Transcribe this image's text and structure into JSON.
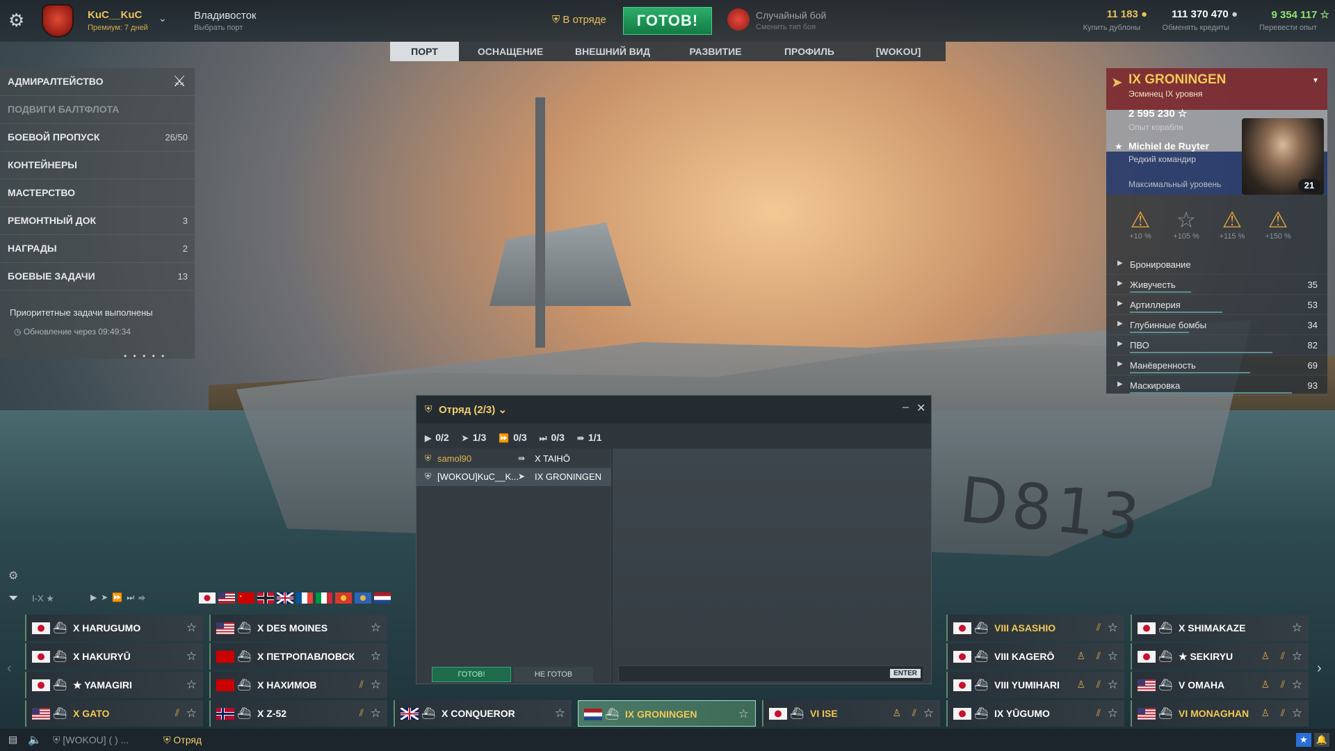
{
  "topbar": {
    "player_name": "KuC__KuC",
    "premium": "Премиум: 7 дней",
    "port_name": "Владивосток",
    "port_sub": "Выбрать порт",
    "division": "В отряде",
    "ready": "ГОТОВ!",
    "mode_name": "Случайный бой",
    "mode_sub": "Сменить тип боя",
    "doubloons": "11 183",
    "doubloons_sub": "Купить дублоны",
    "credits": "111 370 470",
    "credits_sub": "Обменять кредиты",
    "freexp": "9 354 117",
    "freexp_sub": "Перевести опыт"
  },
  "tabs": [
    "ПОРТ",
    "ОСНАЩЕНИЕ",
    "ВНЕШНИЙ ВИД",
    "РАЗВИТИЕ",
    "ПРОФИЛЬ",
    "[WOKOU]"
  ],
  "left_menu": [
    {
      "label": "АДМИРАЛТЕЙСТВО",
      "count": "",
      "dim": false
    },
    {
      "label": "ПОДВИГИ БАЛТФЛОТА",
      "count": "",
      "dim": true
    },
    {
      "label": "БОЕВОЙ ПРОПУСК",
      "count": "26/50",
      "dim": false
    },
    {
      "label": "КОНТЕЙНЕРЫ",
      "count": "",
      "dim": false
    },
    {
      "label": "МАСТЕРСТВО",
      "count": "",
      "dim": false
    },
    {
      "label": "РЕМОНТНЫЙ ДОК",
      "count": "3",
      "dim": false
    },
    {
      "label": "НАГРАДЫ",
      "count": "2",
      "dim": false
    },
    {
      "label": "БОЕВЫЕ ЗАДАЧИ",
      "count": "13",
      "dim": false
    }
  ],
  "left_footer": {
    "priority": "Приоритетные задачи выполнены",
    "update": "Обновление через 09:49:34"
  },
  "ship": {
    "name": "IX GRONINGEN",
    "class": "Эсминец IX уровня",
    "xp": "2 595 230",
    "xp_sub": "Опыт корабля",
    "commander": "Michiel de Ruyter",
    "commander_sub": "Редкий командир",
    "commander_level": "Максимальный уровень",
    "points": "21",
    "modifiers": [
      {
        "value": "+10 %",
        "color": "#e3a23c"
      },
      {
        "value": "+105 %",
        "color": "#8d959b"
      },
      {
        "value": "+115 %",
        "color": "#e3a23c"
      },
      {
        "value": "+150 %",
        "color": "#e3a23c"
      }
    ],
    "stats": [
      {
        "name": "Бронирование",
        "value": "",
        "level": 0
      },
      {
        "name": "Живучесть",
        "value": "35",
        "level": 0.35
      },
      {
        "name": "Артиллерия",
        "value": "53",
        "level": 0.53
      },
      {
        "name": "Глубинные бомбы",
        "value": "34",
        "level": 0.34
      },
      {
        "name": "ПВО",
        "value": "82",
        "level": 0.82
      },
      {
        "name": "Манёвренность",
        "value": "69",
        "level": 0.69
      },
      {
        "name": "Маскировка",
        "value": "93",
        "level": 0.93
      }
    ]
  },
  "division_window": {
    "title": "Отряд (2/3)",
    "filters": [
      {
        "icon": "submarine-icon",
        "label": "0/2"
      },
      {
        "icon": "destroyer-icon",
        "label": "1/3"
      },
      {
        "icon": "cruiser-icon",
        "label": "0/3"
      },
      {
        "icon": "battleship-icon",
        "label": "0/3"
      },
      {
        "icon": "carrier-icon",
        "label": "1/1"
      }
    ],
    "members": [
      {
        "name": "samol90",
        "ship": "X TAIHŌ",
        "color": "#e0b64c",
        "selected": false
      },
      {
        "name": "[WOKOU]KuC__K...",
        "ship": "IX GRONINGEN",
        "color": "#ffffff",
        "selected": true
      }
    ],
    "ready": "ГОТОВ!",
    "not_ready": "НЕ ГОТОВ",
    "enter": "ENTER"
  },
  "filter": {
    "tier": "I-X"
  },
  "carousel": [
    {
      "name": "X HARUGUMO",
      "flag": "jp",
      "prem": false,
      "b1": false,
      "b2": false
    },
    {
      "name": "X HAKURYŪ",
      "flag": "jp",
      "prem": false,
      "b1": false,
      "b2": false
    },
    {
      "name": "★ YAMAGIRI",
      "flag": "jp",
      "prem": false,
      "b1": false,
      "b2": false
    },
    {
      "name": "X GATO",
      "flag": "us",
      "prem": true,
      "b1": true,
      "b2": false
    },
    {
      "name": "X DES MOINES",
      "flag": "us",
      "prem": false,
      "b1": false,
      "b2": false
    },
    {
      "name": "X ПЕТРОПАВЛОВСК",
      "flag": "su",
      "prem": false,
      "b1": false,
      "b2": false
    },
    {
      "name": "X НАХИМОВ",
      "flag": "su",
      "prem": false,
      "b1": true,
      "b2": false
    },
    {
      "name": "X Z-52",
      "flag": "no",
      "prem": false,
      "b1": true,
      "b2": false
    },
    {
      "name": "X CONQUEROR",
      "flag": "uk",
      "prem": false,
      "b1": false,
      "b2": false
    },
    {
      "name": "IX GRONINGEN",
      "flag": "nl",
      "prem": true,
      "b1": false,
      "b2": false
    },
    {
      "name": "VI ISE",
      "flag": "jp",
      "prem": true,
      "b1": true,
      "b2": true
    },
    {
      "name": "VIII ASASHIO",
      "flag": "jp",
      "prem": true,
      "b1": true,
      "b2": false
    },
    {
      "name": "VIII KAGERŌ",
      "flag": "jp",
      "prem": false,
      "b1": true,
      "b2": true
    },
    {
      "name": "VIII YUMIHARI",
      "flag": "jp",
      "prem": false,
      "b1": true,
      "b2": true
    },
    {
      "name": "IX YŪGUMO",
      "flag": "jp",
      "prem": false,
      "b1": true,
      "b2": false
    },
    {
      "name": "X SHIMAKAZE",
      "flag": "jp",
      "prem": false,
      "b1": false,
      "b2": false
    },
    {
      "name": "★ SEKIRYU",
      "flag": "jp",
      "prem": false,
      "b1": true,
      "b2": true
    },
    {
      "name": "V OMAHA",
      "flag": "us",
      "prem": false,
      "b1": true,
      "b2": true
    },
    {
      "name": "VI MONAGHAN",
      "flag": "us",
      "prem": true,
      "b1": true,
      "b2": true
    }
  ],
  "bottombar": {
    "clan": "[WOKOU] ( ) ...",
    "division": "Отряд"
  },
  "colors": {
    "accent": "#f2c954",
    "ready": "#2cae6a",
    "stat_bar": "#5c8f93"
  }
}
